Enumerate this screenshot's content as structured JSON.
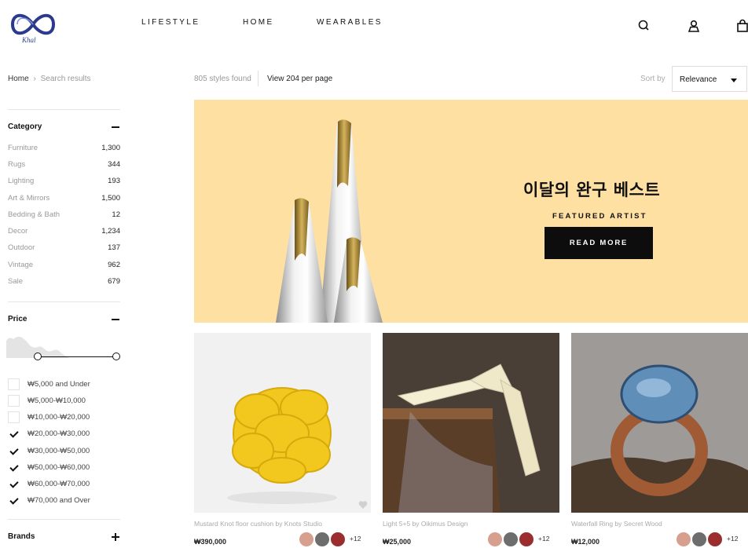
{
  "brand": {
    "logo_text": "Khal"
  },
  "nav": {
    "items": [
      "LIFESTYLE",
      "HOME",
      "WEARABLES"
    ]
  },
  "header_icons": [
    "search-icon",
    "user-icon",
    "bag-icon"
  ],
  "breadcrumb": {
    "home": "Home",
    "separator": "›",
    "current": "Search results"
  },
  "toolbar": {
    "styles_found": "805 styles found",
    "per_page": "View 204 per page",
    "sort_label": "Sort by",
    "sort_value": "Relevance"
  },
  "sidebar": {
    "category": {
      "title": "Category",
      "toggle": "minus",
      "items": [
        {
          "label": "Furniture",
          "count": "1,300"
        },
        {
          "label": "Rugs",
          "count": "344"
        },
        {
          "label": "Lighting",
          "count": "193"
        },
        {
          "label": "Art & Mirrors",
          "count": "1,500"
        },
        {
          "label": "Bedding & Bath",
          "count": "12"
        },
        {
          "label": "Decor",
          "count": "1,234"
        },
        {
          "label": "Outdoor",
          "count": "137"
        },
        {
          "label": "Vintage",
          "count": "962"
        },
        {
          "label": "Sale",
          "count": "679"
        }
      ]
    },
    "price": {
      "title": "Price",
      "toggle": "minus",
      "options": [
        {
          "label": "₩5,000 and Under",
          "checked": false
        },
        {
          "label": "₩5,000-₩10,000",
          "checked": false
        },
        {
          "label": "₩10,000-₩20,000",
          "checked": false
        },
        {
          "label": "₩20,000-₩30,000",
          "checked": true
        },
        {
          "label": "₩30,000-₩50,000",
          "checked": true
        },
        {
          "label": "₩50,000-₩60,000",
          "checked": true
        },
        {
          "label": "₩60,000-₩70,000",
          "checked": true
        },
        {
          "label": "₩70,000 and Over",
          "checked": true
        }
      ]
    },
    "brands": {
      "title": "Brands",
      "toggle": "plus"
    }
  },
  "hero": {
    "title": "이달의 완구 베스트",
    "subtitle": "FEATURED ARTIST",
    "button": "READ MORE",
    "background": "#fde0a2"
  },
  "products": [
    {
      "title": "Mustard Knot floor cushion by Knots Studio",
      "price": "₩390,000",
      "more": "+12"
    },
    {
      "title": "Light 5+5 by Oikimus Design",
      "price": "₩25,000",
      "more": "+12"
    },
    {
      "title": "Waterfall Ring by Secret Wood",
      "price": "₩12,000",
      "more": "+12"
    }
  ]
}
